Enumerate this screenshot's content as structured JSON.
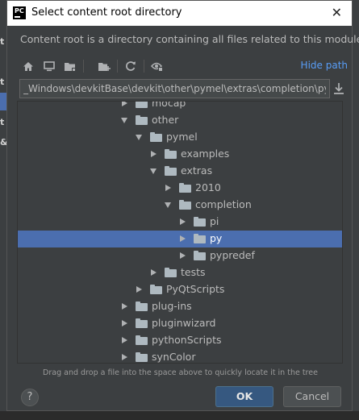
{
  "dialog": {
    "title": "Select content root directory",
    "app_icon_text": "PC",
    "description": "Content root is a directory containing all files related to this module",
    "hide_path_label": "Hide path",
    "path_value": "_Windows\\devkitBase\\devkit\\other\\pymel\\extras\\completion\\py",
    "hint": "Drag and drop a file into the space above to quickly locate it in the tree",
    "ok_label": "OK",
    "cancel_label": "Cancel",
    "help_label": "?"
  },
  "background": {
    "fragments": [
      "t",
      "t",
      "ru",
      "t",
      "&"
    ]
  },
  "toolbar": {
    "icons": [
      "home-icon",
      "desktop-icon",
      "project-folder-icon",
      "new-folder-icon",
      "refresh-icon",
      "show-hidden-icon"
    ]
  },
  "tree": {
    "rows": [
      {
        "label": "mocap",
        "depth": 0,
        "expanded": false
      },
      {
        "label": "other",
        "depth": 0,
        "expanded": true
      },
      {
        "label": "pymel",
        "depth": 1,
        "expanded": true
      },
      {
        "label": "examples",
        "depth": 2,
        "expanded": false
      },
      {
        "label": "extras",
        "depth": 2,
        "expanded": true
      },
      {
        "label": "2010",
        "depth": 3,
        "expanded": false
      },
      {
        "label": "completion",
        "depth": 3,
        "expanded": true
      },
      {
        "label": "pi",
        "depth": 4,
        "expanded": false
      },
      {
        "label": "py",
        "depth": 4,
        "expanded": false,
        "selected": true
      },
      {
        "label": "pypredef",
        "depth": 4,
        "expanded": false
      },
      {
        "label": "tests",
        "depth": 2,
        "expanded": false
      },
      {
        "label": "PyQtScripts",
        "depth": 1,
        "expanded": false
      },
      {
        "label": "plug-ins",
        "depth": 0,
        "expanded": false
      },
      {
        "label": "pluginwizard",
        "depth": 0,
        "expanded": false
      },
      {
        "label": "pythonScripts",
        "depth": 0,
        "expanded": false
      },
      {
        "label": "synColor",
        "depth": 0,
        "expanded": false
      }
    ]
  },
  "colors": {
    "selection": "#4b6eaf",
    "link": "#589df6",
    "ok_button": "#365880"
  }
}
